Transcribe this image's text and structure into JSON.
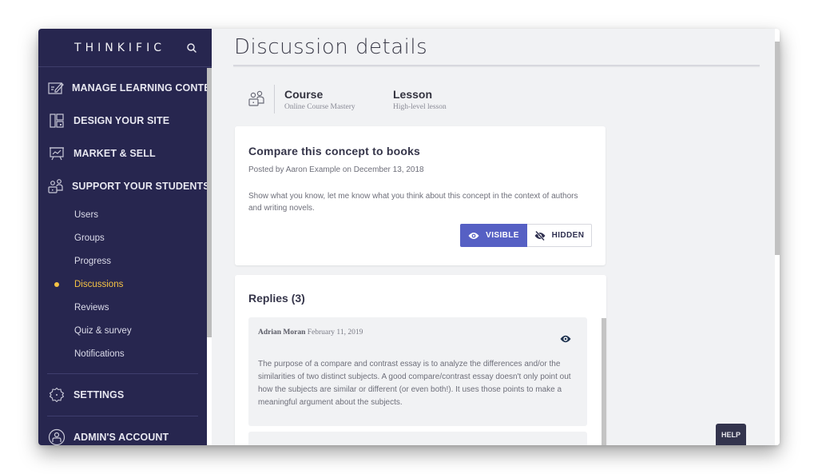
{
  "sidebar": {
    "brand": "THINKIFIC",
    "search_icon": "search-icon",
    "main_items": [
      {
        "label": "MANAGE LEARNING CONTENT",
        "icon": "edit-board-icon"
      },
      {
        "label": "DESIGN YOUR SITE",
        "icon": "layout-icon"
      },
      {
        "label": "MARKET & SELL",
        "icon": "presentation-chart-icon"
      },
      {
        "label": "SUPPORT YOUR STUDENTS",
        "icon": "students-icon"
      }
    ],
    "sub_items": [
      {
        "label": "Users",
        "active": false
      },
      {
        "label": "Groups",
        "active": false
      },
      {
        "label": "Progress",
        "active": false
      },
      {
        "label": "Discussions",
        "active": true
      },
      {
        "label": "Reviews",
        "active": false
      },
      {
        "label": "Quiz & survey",
        "active": false
      },
      {
        "label": "Notifications",
        "active": false
      }
    ],
    "settings": {
      "label": "SETTINGS",
      "icon": "gear-icon"
    },
    "account": {
      "label": "ADMIN'S ACCOUNT",
      "icon": "user-circle-icon"
    },
    "active_color": "#f6c344",
    "background": "#27264f"
  },
  "main": {
    "title": "Discussion details",
    "meta": {
      "icon": "students-icon",
      "course_label": "Course",
      "course_value": "Online Course Mastery",
      "lesson_label": "Lesson",
      "lesson_value": "High-level lesson"
    },
    "post": {
      "title": "Compare this concept to books",
      "posted_by": "Posted by Aaron Example on December 13, 2018",
      "body": "Show what you know, let me know what you think about this concept in the context of authors and writing novels.",
      "visibility": {
        "visible_label": "VISIBLE",
        "hidden_label": "HIDDEN",
        "selected": "VISIBLE",
        "accent": "#5660c4"
      }
    },
    "replies": {
      "title": "Replies (3)",
      "items": [
        {
          "author": "Adrian Moran",
          "date": "February 11, 2019",
          "visibility_icon": "eye-icon",
          "text": "The purpose of a compare and contrast essay is to analyze the differences and/or the similarities of two distinct subjects. A good compare/contrast essay doesn't only point out how the subjects are similar or different (or even both!). It uses those points to make a meaningful argument about the subjects."
        }
      ]
    }
  },
  "help": {
    "label": "HELP"
  }
}
